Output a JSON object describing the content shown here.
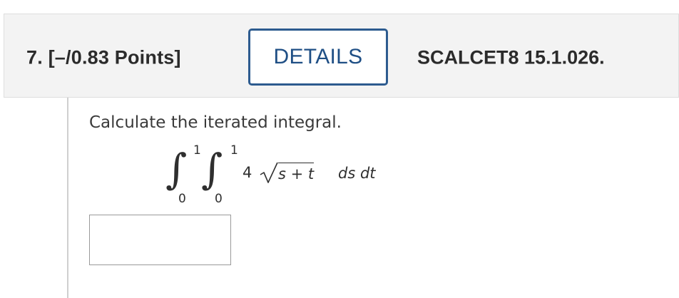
{
  "question": {
    "number_and_points": "7.  [–/0.83 Points]",
    "details_label": "DETAILS",
    "source_code": "SCALCET8 15.1.026."
  },
  "prompt": {
    "text": "Calculate the iterated integral."
  },
  "integral": {
    "outer_upper_limit": "1",
    "outer_lower_limit": "0",
    "inner_upper_limit": "1",
    "inner_lower_limit": "0",
    "coefficient": "4",
    "radicand": "s + t",
    "differentials": "ds dt"
  },
  "answer": {
    "value": ""
  },
  "colors": {
    "header_background": "#f3f3f3",
    "details_border": "#2d5b8f",
    "details_text": "#1f4f85",
    "text": "#2b2b2b"
  }
}
